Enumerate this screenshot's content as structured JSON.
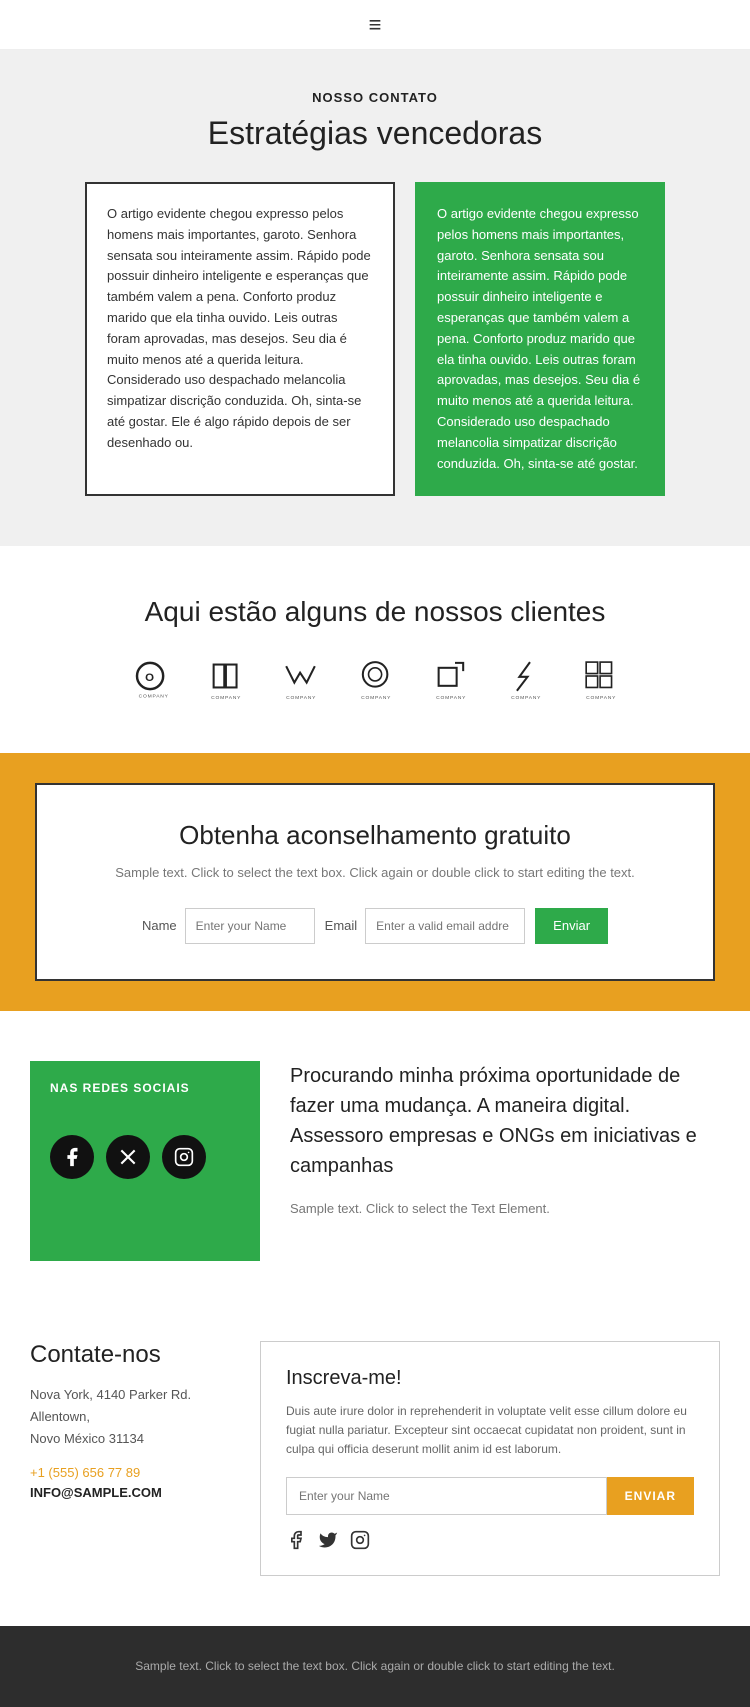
{
  "header": {
    "hamburger": "≡"
  },
  "nosso_contato": {
    "label": "NOSSO CONTATO",
    "title": "Estratégias vencedoras",
    "card_white_text": "O artigo evidente chegou expresso pelos homens mais importantes, garoto. Senhora sensata sou inteiramente assim. Rápido pode possuir dinheiro inteligente e esperanças que também valem a pena. Conforto produz marido que ela tinha ouvido. Leis outras foram aprovadas, mas desejos. Seu dia é muito menos até a querida leitura. Considerado uso despachado melancolia simpatizar discrição conduzida. Oh, sinta-se até gostar. Ele é algo rápido depois de ser desenhado ou.",
    "card_green_text": "O artigo evidente chegou expresso pelos homens mais importantes, garoto. Senhora sensata sou inteiramente assim. Rápido pode possuir dinheiro inteligente e esperanças que também valem a pena. Conforto produz marido que ela tinha ouvido. Leis outras foram aprovadas, mas desejos. Seu dia é muito menos até a querida leitura. Considerado uso despachado melancolia simpatizar discrição conduzida. Oh, sinta-se até gostar."
  },
  "clientes": {
    "title": "Aqui estão alguns de nossos clientes",
    "logos": [
      {
        "label": "COMPANY"
      },
      {
        "label": "COMPANY"
      },
      {
        "label": "COMPANY"
      },
      {
        "label": "COMPANY"
      },
      {
        "label": "COMPANY"
      },
      {
        "label": "COMPANY"
      },
      {
        "label": "COMPANY"
      }
    ]
  },
  "aconselhamento": {
    "title": "Obtenha aconselhamento gratuito",
    "subtitle": "Sample text. Click to select the text box. Click again\nor double click to start editing the text.",
    "name_label": "Name",
    "name_placeholder": "Enter your Name",
    "email_label": "Email",
    "email_placeholder": "Enter a valid email addre",
    "button_label": "Enviar"
  },
  "redes": {
    "box_title": "NAS REDES SOCIAIS",
    "big_text": "Procurando minha próxima oportunidade de fazer uma mudança. A maneira digital. Assessoro empresas e ONGs em iniciativas e campanhas",
    "small_text": "Sample text. Click to select the Text Element.",
    "facebook_icon": "f",
    "twitter_icon": "𝕏",
    "instagram_icon": "◎"
  },
  "contate": {
    "title": "Contate-nos",
    "address": "Nova York, 4140 Parker Rd.\nAllentown,\nNovo México 31134",
    "phone": "+1 (555) 656 77 89",
    "email": "INFO@SAMPLE.COM",
    "inscreva_title": "Inscreva-me!",
    "inscreva_desc": "Duis aute irure dolor in reprehenderit in voluptate velit esse cillum dolore eu fugiat nulla pariatur. Excepteur sint occaecat cupidatat non proident, sunt in culpa qui officia deserunt mollit anim id est laborum.",
    "inscreva_placeholder": "Enter your Name",
    "inscreva_button": "ENVIAR",
    "social_facebook": "f",
    "social_twitter": "🐦",
    "social_instagram": "◎"
  },
  "footer": {
    "text": "Sample text. Click to select the text box. Click again or double\nclick to start editing the text."
  }
}
